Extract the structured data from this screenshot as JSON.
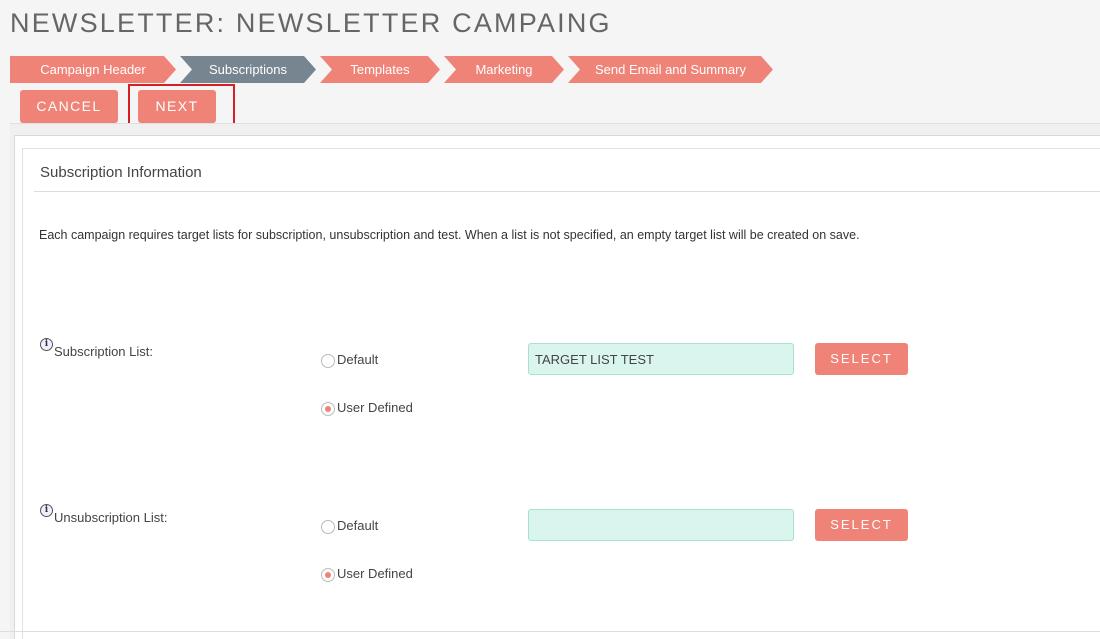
{
  "page": {
    "title": "NEWSLETTER: NEWSLETTER CAMPAING"
  },
  "steps": [
    {
      "label": "Campaign Header",
      "active": false
    },
    {
      "label": "Subscriptions",
      "active": true
    },
    {
      "label": "Templates",
      "active": false
    },
    {
      "label": "Marketing",
      "active": false
    },
    {
      "label": "Send Email and Summary",
      "active": false
    }
  ],
  "actions": {
    "cancel_label": "CANCEL",
    "next_label": "NEXT"
  },
  "section": {
    "title": "Subscription Information",
    "description": "Each campaign requires target lists for subscription, unsubscription and test. When a list is not specified, an empty target list will be created on save."
  },
  "subscription": {
    "label": "Subscription List:",
    "option_default": "Default",
    "option_user_defined": "User Defined",
    "selected": "User Defined",
    "value": "TARGET LIST TEST",
    "select_label": "SELECT"
  },
  "unsubscription": {
    "label": "Unsubscription List:",
    "option_default": "Default",
    "option_user_defined": "User Defined",
    "selected": "User Defined",
    "value": "",
    "select_label": "SELECT"
  },
  "colors": {
    "accent": "#f08377",
    "active_step": "#778591",
    "input_bg": "#d9f5ee",
    "highlight": "#d41f24"
  },
  "icons": {
    "info": "info-icon"
  }
}
